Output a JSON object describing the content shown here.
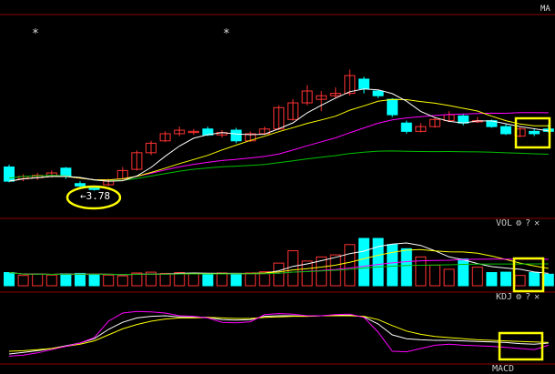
{
  "main_panel": {
    "indicator_label": "MA",
    "low_price_label": "←3.78",
    "star_markers": [
      "*",
      "*"
    ]
  },
  "vol_panel": {
    "label": "VOL",
    "gear": "⚙",
    "help": "?",
    "close": "✕"
  },
  "kdj_panel": {
    "label": "KDJ",
    "gear": "⚙",
    "help": "?",
    "close": "✕"
  },
  "macd_panel": {
    "label": "MACD"
  },
  "colors": {
    "up": "#ff3232",
    "down": "#00ffff",
    "ma5": "#ffffff",
    "ma10": "#ffff00",
    "ma20": "#ff00ff",
    "ma60": "#00c000",
    "highlight": "#ffff00",
    "grid": "#8b0000"
  },
  "chart_data": {
    "type": "candlestick",
    "series": [
      {
        "name": "candles",
        "ohlc": [
          [
            3.98,
            3.86,
            4.0,
            3.85
          ],
          [
            3.88,
            3.9,
            3.92,
            3.86
          ],
          [
            3.89,
            3.91,
            3.93,
            3.87
          ],
          [
            3.9,
            3.93,
            3.95,
            3.89
          ],
          [
            3.97,
            3.9,
            3.98,
            3.88
          ],
          [
            3.84,
            3.82,
            3.86,
            3.8
          ],
          [
            3.8,
            3.79,
            3.82,
            3.78
          ],
          [
            3.83,
            3.86,
            3.88,
            3.82
          ],
          [
            3.88,
            3.95,
            3.98,
            3.87
          ],
          [
            3.96,
            4.1,
            4.12,
            3.95
          ],
          [
            4.1,
            4.18,
            4.2,
            4.08
          ],
          [
            4.2,
            4.26,
            4.28,
            4.19
          ],
          [
            4.26,
            4.29,
            4.32,
            4.24
          ],
          [
            4.27,
            4.28,
            4.3,
            4.25
          ],
          [
            4.3,
            4.25,
            4.32,
            4.24
          ],
          [
            4.25,
            4.27,
            4.29,
            4.23
          ],
          [
            4.29,
            4.2,
            4.31,
            4.18
          ],
          [
            4.2,
            4.26,
            4.28,
            4.19
          ],
          [
            4.26,
            4.3,
            4.32,
            4.25
          ],
          [
            4.3,
            4.48,
            4.5,
            4.29
          ],
          [
            4.38,
            4.52,
            4.55,
            4.37
          ],
          [
            4.52,
            4.62,
            4.67,
            4.5
          ],
          [
            4.55,
            4.58,
            4.62,
            4.45
          ],
          [
            4.58,
            4.6,
            4.65,
            4.56
          ],
          [
            4.6,
            4.75,
            4.8,
            4.58
          ],
          [
            4.72,
            4.64,
            4.74,
            4.6
          ],
          [
            4.62,
            4.58,
            4.63,
            4.56
          ],
          [
            4.55,
            4.42,
            4.56,
            4.4
          ],
          [
            4.35,
            4.28,
            4.37,
            4.26
          ],
          [
            4.28,
            4.32,
            4.35,
            4.27
          ],
          [
            4.32,
            4.38,
            4.4,
            4.31
          ],
          [
            4.37,
            4.42,
            4.45,
            4.36
          ],
          [
            4.41,
            4.35,
            4.43,
            4.33
          ],
          [
            4.36,
            4.37,
            4.4,
            4.35
          ],
          [
            4.37,
            4.32,
            4.38,
            4.31
          ],
          [
            4.32,
            4.26,
            4.34,
            4.25
          ],
          [
            4.24,
            4.3,
            4.32,
            4.23
          ],
          [
            4.28,
            4.26,
            4.3,
            4.24
          ],
          [
            4.3,
            4.28,
            4.34,
            4.27
          ]
        ]
      },
      {
        "name": "vol",
        "values": [
          3.2,
          2.5,
          2.8,
          2.6,
          2.9,
          3.0,
          2.7,
          2.6,
          2.4,
          3.1,
          3.3,
          3.0,
          3.2,
          2.9,
          2.8,
          3.1,
          3.0,
          3.1,
          3.4,
          5.5,
          8.5,
          6.0,
          7.0,
          7.5,
          10.0,
          11.5,
          11.5,
          10.0,
          9.0,
          7.0,
          5.0,
          4.0,
          6.5,
          4.5,
          3.2,
          3.3,
          2.5,
          3.2,
          2.8
        ]
      },
      {
        "name": "K",
        "values": [
          10,
          13,
          16,
          20,
          25,
          30,
          38,
          55,
          68,
          76,
          79,
          80,
          78,
          78,
          77,
          73,
          72,
          73,
          79,
          80,
          80,
          79,
          80,
          81,
          81,
          78,
          65,
          45,
          38,
          36,
          35,
          35,
          34,
          33,
          32,
          31,
          29,
          28,
          30
        ]
      },
      {
        "name": "D",
        "values": [
          15,
          16,
          18,
          20,
          24,
          28,
          34,
          45,
          56,
          64,
          70,
          74,
          76,
          76,
          77,
          76,
          75,
          75,
          77,
          78,
          79,
          79,
          80,
          80,
          80,
          79,
          73,
          62,
          52,
          46,
          42,
          40,
          38,
          36,
          35,
          34,
          33,
          32,
          31
        ]
      },
      {
        "name": "J",
        "values": [
          6,
          8,
          12,
          18,
          24,
          30,
          40,
          70,
          85,
          88,
          87,
          85,
          80,
          79,
          76,
          68,
          67,
          69,
          82,
          84,
          83,
          80,
          80,
          82,
          83,
          77,
          50,
          15,
          14,
          20,
          26,
          28,
          26,
          25,
          24,
          22,
          20,
          18,
          26
        ]
      }
    ]
  }
}
